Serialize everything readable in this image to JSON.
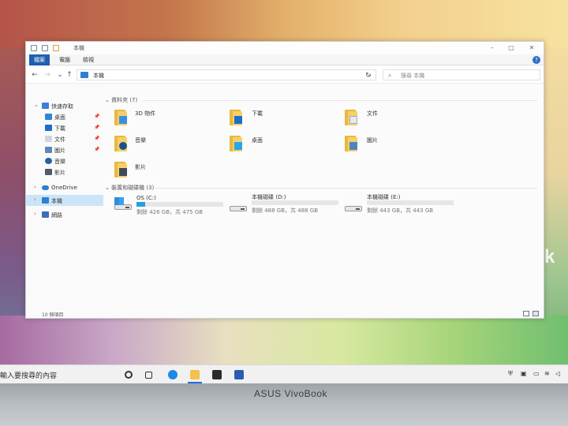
{
  "window": {
    "title": "本機",
    "ribbon_tabs": [
      "檔案",
      "電腦",
      "檢視"
    ],
    "help_label": "?",
    "address": "本機",
    "search_placeholder": "搜尋 本機",
    "status": "10 個項目"
  },
  "sidebar": {
    "quick_access": "快速存取",
    "quick_items": [
      "桌面",
      "下載",
      "文件",
      "圖片",
      "音樂",
      "影片"
    ],
    "onedrive": "OneDrive",
    "this_pc": "本機",
    "network": "網路"
  },
  "content": {
    "folders_header": "資料夾 (7)",
    "folders": [
      "3D 物件",
      "下載",
      "文件",
      "音樂",
      "桌面",
      "圖片",
      "影片"
    ],
    "drives_header": "裝置和磁碟機 (3)",
    "drives": [
      {
        "name": "OS (C:)",
        "free_text": "剩餘 426 GB，共 475 GB",
        "used_fraction": 0.103
      },
      {
        "name": "本機磁碟 (D:)",
        "free_text": "剩餘 488 GB，共 488 GB",
        "used_fraction": 0.0
      },
      {
        "name": "本機磁碟 (E:)",
        "free_text": "剩餘 443 GB，共 443 GB",
        "used_fraction": 0.0
      }
    ]
  },
  "taskbar": {
    "search_text": "輸入要搜尋的內容",
    "bezel_brand": "ASUS VivoBook"
  },
  "background": {
    "brand_fragment": "k"
  },
  "colors": {
    "accent": "#1f5fb0",
    "drive_bar": "#26a0da",
    "folder": "#f5cf6a",
    "selection": "#cce4f7"
  }
}
